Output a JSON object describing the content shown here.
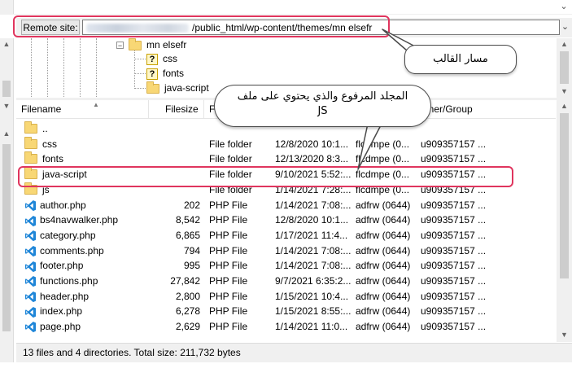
{
  "remote": {
    "label": "Remote site:",
    "path_visible": "/public_html/wp-content/themes/mn elsefr",
    "dropdown_glyph": "⌄"
  },
  "tree": {
    "items": [
      {
        "name": "mn elsefr",
        "type": "folder",
        "icon": "folder-icon",
        "expanded": true
      },
      {
        "name": "css",
        "type": "unknown",
        "icon": "question-icon"
      },
      {
        "name": "fonts",
        "type": "unknown",
        "icon": "question-icon"
      },
      {
        "name": "java-script",
        "type": "folder",
        "icon": "folder-icon"
      }
    ]
  },
  "columns": [
    "Filename",
    "Filesize",
    "F",
    "",
    "",
    "wner/Group"
  ],
  "rows": [
    {
      "name": "..",
      "size": "",
      "type": "",
      "modified": "",
      "perms": "",
      "owner": "",
      "icon": "folder-icon"
    },
    {
      "name": "css",
      "size": "",
      "type": "File folder",
      "modified": "12/8/2020 10:1...",
      "perms": "flcdmpe (0...",
      "owner": "u909357157 ...",
      "icon": "folder-icon"
    },
    {
      "name": "fonts",
      "size": "",
      "type": "File folder",
      "modified": "12/13/2020 8:3...",
      "perms": "flcdmpe (0...",
      "owner": "u909357157 ...",
      "icon": "folder-icon"
    },
    {
      "name": "java-script",
      "size": "",
      "type": "File folder",
      "modified": "9/10/2021 5:52:...",
      "perms": "flcdmpe (0...",
      "owner": "u909357157 ...",
      "icon": "folder-icon"
    },
    {
      "name": "js",
      "size": "",
      "type": "File folder",
      "modified": "1/14/2021 7:28:...",
      "perms": "flcdmpe (0...",
      "owner": "u909357157 ...",
      "icon": "folder-icon"
    },
    {
      "name": "author.php",
      "size": "202",
      "type": "PHP File",
      "modified": "1/14/2021 7:08:...",
      "perms": "adfrw (0644)",
      "owner": "u909357157 ...",
      "icon": "vscode-icon"
    },
    {
      "name": "bs4navwalker.php",
      "size": "8,542",
      "type": "PHP File",
      "modified": "12/8/2020 10:1...",
      "perms": "adfrw (0644)",
      "owner": "u909357157 ...",
      "icon": "vscode-icon"
    },
    {
      "name": "category.php",
      "size": "6,865",
      "type": "PHP File",
      "modified": "1/17/2021 11:4...",
      "perms": "adfrw (0644)",
      "owner": "u909357157 ...",
      "icon": "vscode-icon"
    },
    {
      "name": "comments.php",
      "size": "794",
      "type": "PHP File",
      "modified": "1/14/2021 7:08:...",
      "perms": "adfrw (0644)",
      "owner": "u909357157 ...",
      "icon": "vscode-icon"
    },
    {
      "name": "footer.php",
      "size": "995",
      "type": "PHP File",
      "modified": "1/14/2021 7:08:...",
      "perms": "adfrw (0644)",
      "owner": "u909357157 ...",
      "icon": "vscode-icon"
    },
    {
      "name": "functions.php",
      "size": "27,842",
      "type": "PHP File",
      "modified": "9/7/2021 6:35:2...",
      "perms": "adfrw (0644)",
      "owner": "u909357157 ...",
      "icon": "vscode-icon"
    },
    {
      "name": "header.php",
      "size": "2,800",
      "type": "PHP File",
      "modified": "1/15/2021 10:4...",
      "perms": "adfrw (0644)",
      "owner": "u909357157 ...",
      "icon": "vscode-icon"
    },
    {
      "name": "index.php",
      "size": "6,278",
      "type": "PHP File",
      "modified": "1/15/2021 8:55:...",
      "perms": "adfrw (0644)",
      "owner": "u909357157 ...",
      "icon": "vscode-icon"
    },
    {
      "name": "page.php",
      "size": "2,629",
      "type": "PHP File",
      "modified": "1/14/2021 11:0...",
      "perms": "adfrw (0644)",
      "owner": "u909357157 ...",
      "icon": "vscode-icon"
    }
  ],
  "status": "13 files and 4 directories. Total size: 211,732 bytes",
  "callouts": {
    "theme_path": "مسار القالب",
    "uploaded_folder_line1": "المجلد المرفوع والذي يحتوي على ملف",
    "uploaded_folder_line2": "JS"
  },
  "colors": {
    "highlight": "#e0355e",
    "folder": "#f8d775",
    "vscode_blue": "#1f86d8"
  }
}
